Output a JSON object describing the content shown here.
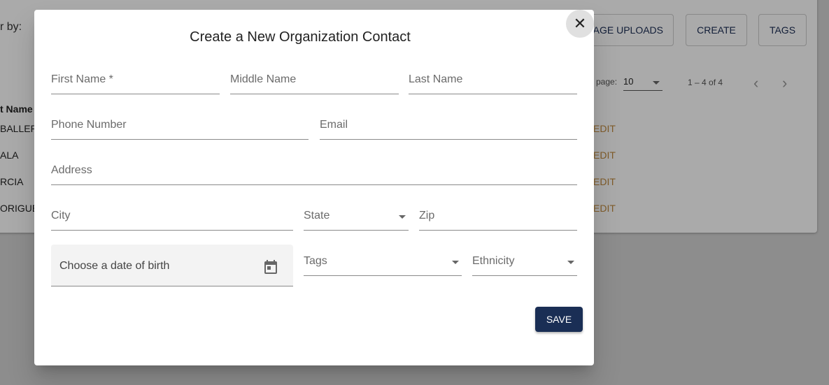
{
  "background": {
    "filter_label": "r by:",
    "buttons": [
      "AGE UPLOADS",
      "CREATE",
      "TAGS"
    ],
    "per_page_label": "page:",
    "per_page_value": "10",
    "range": "1 – 4 of 4",
    "column_header": "t Name",
    "rows": [
      "BALLER",
      "ALA",
      "RCIA",
      "ORIGUE"
    ],
    "edit_label": "EDIT"
  },
  "dialog": {
    "title": "Create a New Organization Contact",
    "fields": {
      "first_name": "First Name *",
      "middle_name": "Middle Name",
      "last_name": "Last Name",
      "phone": "Phone Number",
      "email": "Email",
      "address": "Address",
      "city": "City",
      "state": "State",
      "zip": "Zip",
      "dob": "Choose a date of birth",
      "tags": "Tags",
      "ethnicity": "Ethnicity"
    },
    "save_label": "SAVE"
  },
  "colors": {
    "primary": "#1a2e55",
    "accent": "#c08a3e"
  }
}
